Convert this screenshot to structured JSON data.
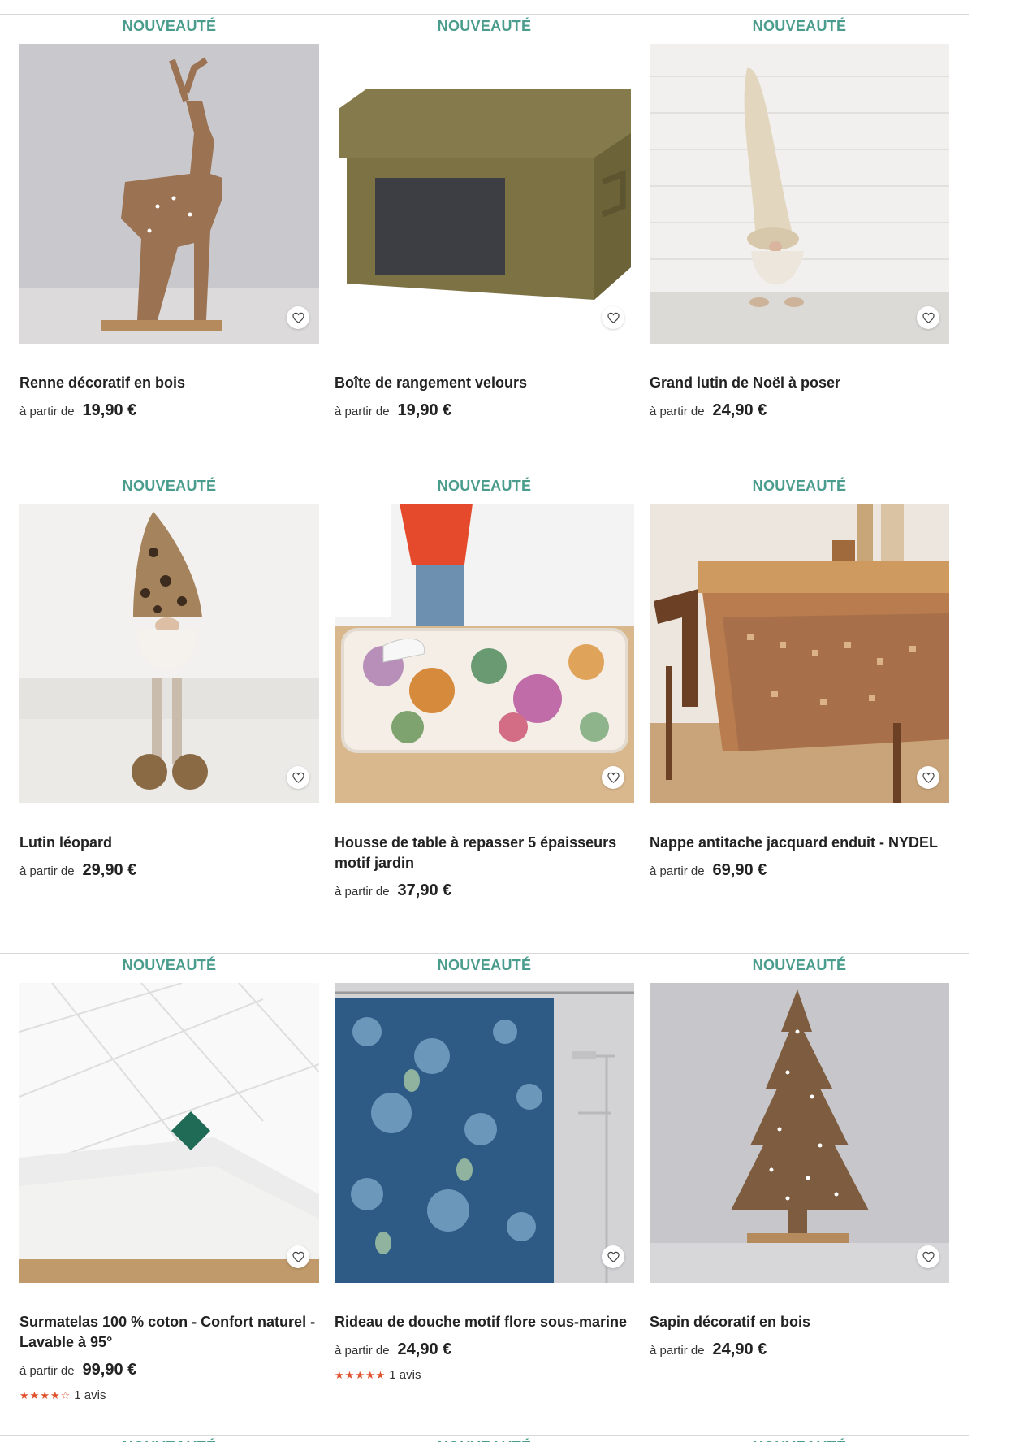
{
  "badge": "NOUVEAUTÉ",
  "from_label": "à partir de",
  "colors": {
    "badge": "#4a9c8c",
    "stars": "#e0512b",
    "separator": "#d8d8d8"
  },
  "products": [
    {
      "name": "Renne décoratif en bois",
      "price": "19,90 €",
      "image": "wooden-reindeer",
      "favorite_icon": "heart-icon"
    },
    {
      "name": "Boîte de rangement velours",
      "price": "19,90 €",
      "image": "velvet-storage-box",
      "favorite_icon": "heart-icon"
    },
    {
      "name": "Grand lutin de Noël à poser",
      "price": "24,90 €",
      "image": "christmas-gnome",
      "favorite_icon": "heart-icon"
    },
    {
      "name": "Lutin léopard",
      "price": "29,90 €",
      "image": "leopard-gnome",
      "favorite_icon": "heart-icon"
    },
    {
      "name": "Housse de table à repasser 5 épaisseurs motif jardin",
      "price": "37,90 €",
      "image": "ironing-board-cover",
      "favorite_icon": "heart-icon"
    },
    {
      "name": "Nappe antitache jacquard enduit - NYDEL",
      "price": "69,90 €",
      "image": "jacquard-tablecloth",
      "favorite_icon": "heart-icon"
    },
    {
      "name": "Surmatelas 100 % coton - Confort naturel - Lavable à 95°",
      "price": "99,90 €",
      "image": "mattress-topper",
      "favorite_icon": "heart-icon",
      "rating": 4,
      "reviews": "1 avis"
    },
    {
      "name": "Rideau de douche motif flore sous-marine",
      "price": "24,90 €",
      "image": "shower-curtain",
      "favorite_icon": "heart-icon",
      "rating": 5,
      "reviews": "1 avis"
    },
    {
      "name": "Sapin décoratif en bois",
      "price": "24,90 €",
      "image": "wooden-christmas-tree",
      "favorite_icon": "heart-icon"
    }
  ]
}
